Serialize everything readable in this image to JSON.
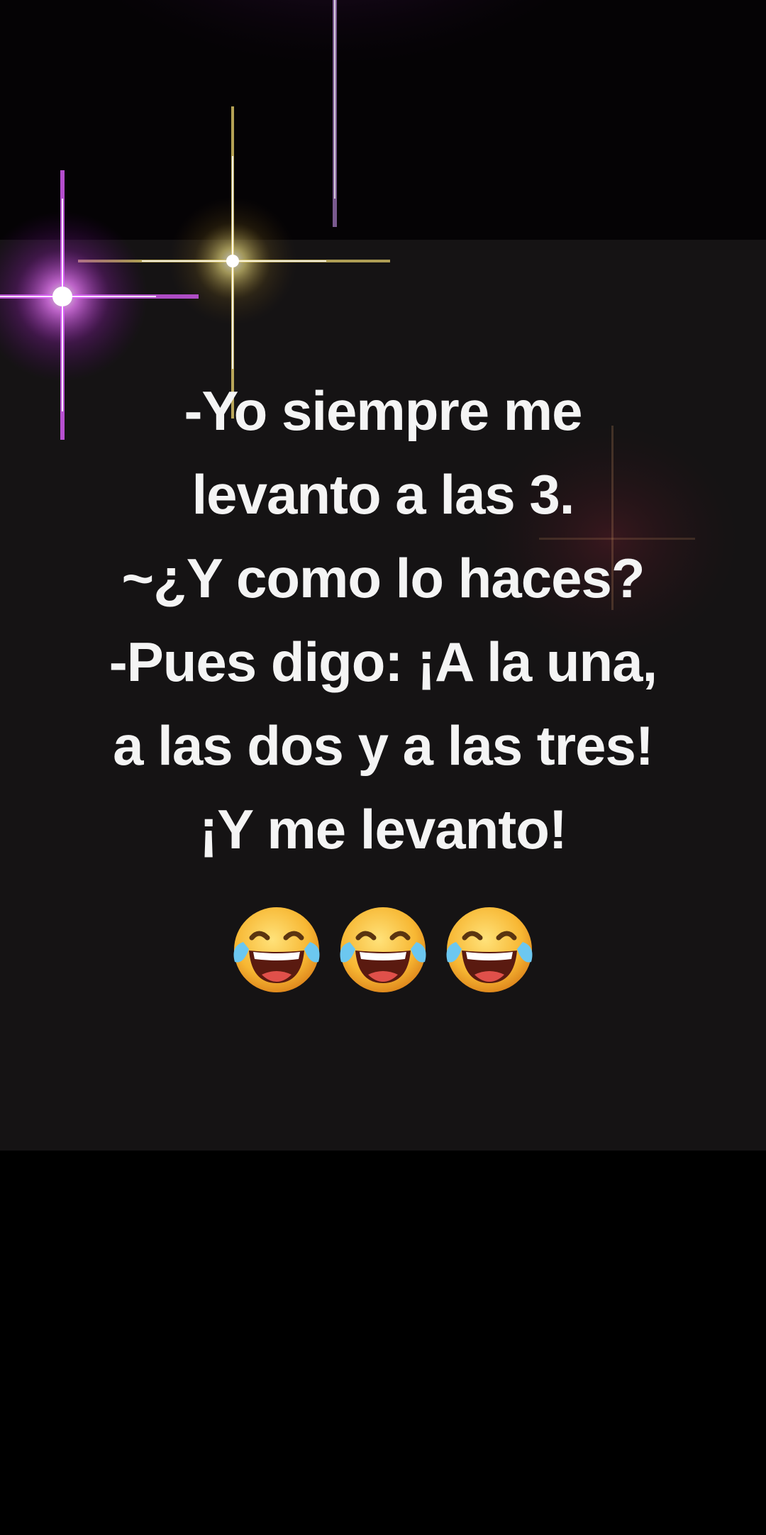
{
  "meme": {
    "lines": [
      "-Yo siempre me",
      "levanto a las 3.",
      "~¿Y como lo haces?",
      "-Pues digo: ¡A la una,",
      "a las dos y a las tres!",
      "¡Y me levanto!"
    ],
    "emojis": [
      "face-with-tears-of-joy-icon",
      "face-with-tears-of-joy-icon",
      "face-with-tears-of-joy-icon"
    ]
  },
  "colors": {
    "background": "#000000",
    "panel": "#151314",
    "text": "#f4f4f4",
    "sparkle_pink": "#e03cff",
    "sparkle_gold": "#e8d060"
  }
}
